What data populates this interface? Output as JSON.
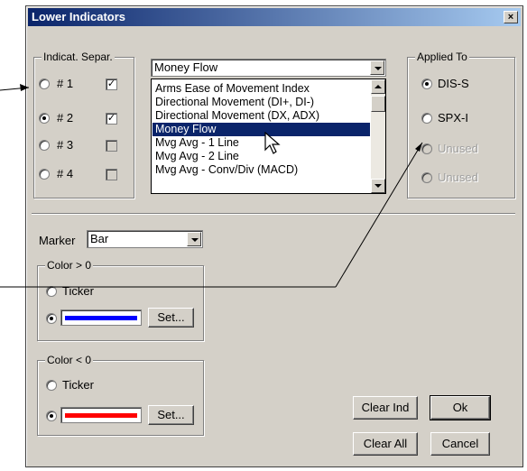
{
  "window": {
    "title": "Lower Indicators",
    "close_label": "×"
  },
  "indicators": {
    "legend": "Indicat. Separ.",
    "rows": [
      {
        "label": "# 1",
        "selected": false,
        "checked": true,
        "enabled": true
      },
      {
        "label": "# 2",
        "selected": true,
        "checked": true,
        "enabled": true
      },
      {
        "label": "# 3",
        "selected": false,
        "checked": false,
        "enabled": false
      },
      {
        "label": "# 4",
        "selected": false,
        "checked": false,
        "enabled": false
      }
    ],
    "check_mark": "✓"
  },
  "indicator_combo": {
    "value": "Money Flow"
  },
  "indicator_list": {
    "items": [
      "Arms Ease of Movement Index",
      "Directional Movement (DI+, DI-)",
      "Directional Movement (DX, ADX)",
      "Money Flow",
      "Mvg Avg - 1 Line",
      "Mvg Avg - 2 Line",
      "Mvg Avg - Conv/Div (MACD)"
    ],
    "selected_index": 3
  },
  "applied_to": {
    "legend": "Applied To",
    "options": [
      {
        "label": "DIS-S",
        "selected": true,
        "enabled": true
      },
      {
        "label": "SPX-I",
        "selected": false,
        "enabled": true
      },
      {
        "label": "Unused",
        "selected": false,
        "enabled": false
      },
      {
        "label": "Unused",
        "selected": false,
        "enabled": false
      }
    ]
  },
  "marker": {
    "label": "Marker",
    "value": "Bar"
  },
  "color_pos": {
    "legend": "Color > 0",
    "ticker_label": "Ticker",
    "set_label": "Set...",
    "color": "#0000ff"
  },
  "color_neg": {
    "legend": "Color < 0",
    "ticker_label": "Ticker",
    "set_label": "Set...",
    "color": "#ff0000"
  },
  "buttons": {
    "clear_ind": "Clear Ind",
    "ok": "Ok",
    "clear_all": "Clear All",
    "cancel": "Cancel"
  }
}
